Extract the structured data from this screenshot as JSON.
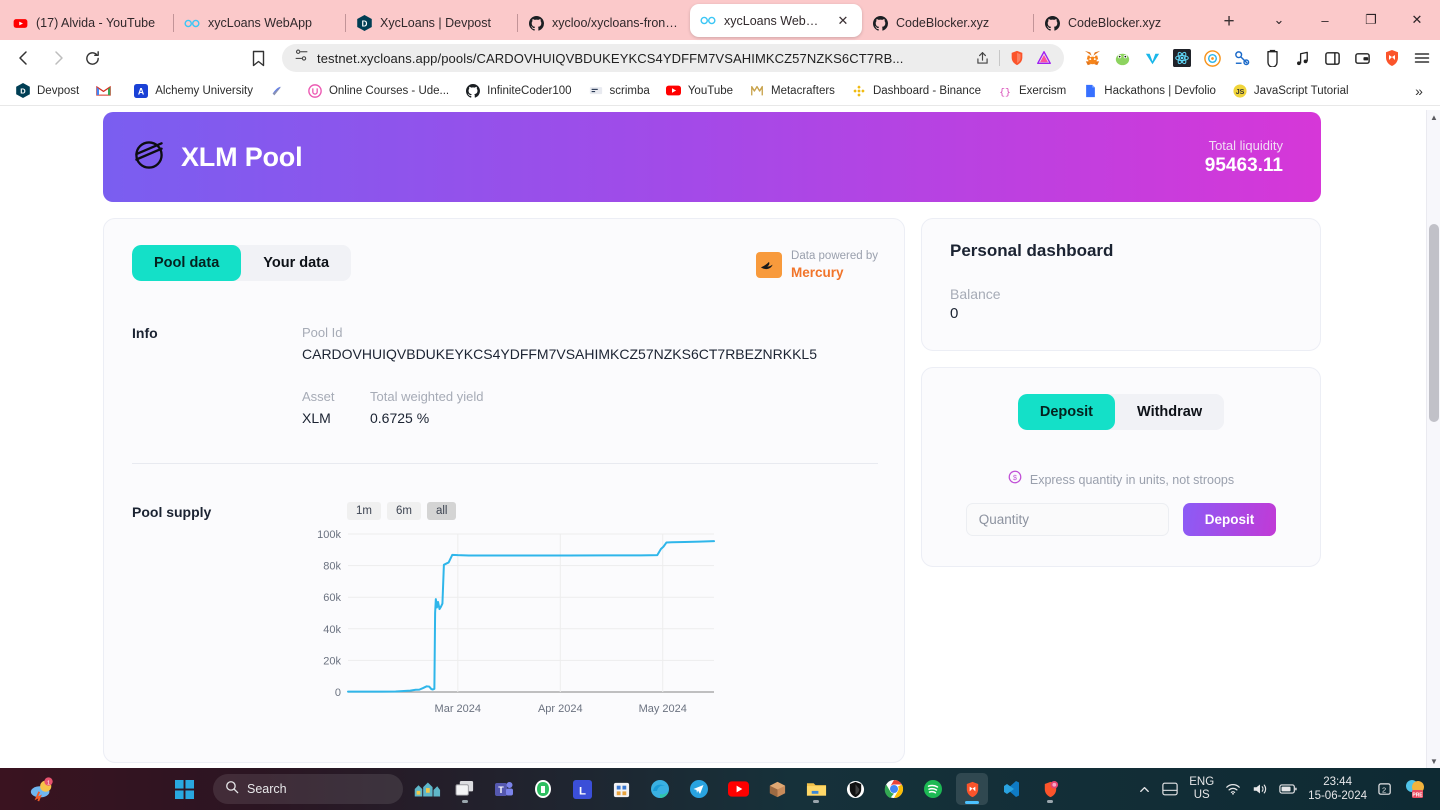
{
  "browser": {
    "tabs": [
      {
        "title": "(17) Alvida - YouTube",
        "icon": "youtube-icon",
        "active": false
      },
      {
        "title": "xycLoans WebApp",
        "icon": "infinity-icon",
        "active": false
      },
      {
        "title": "XycLoans | Devpost",
        "icon": "devpost-icon",
        "active": false
      },
      {
        "title": "xycloo/xycloans-frontend:",
        "icon": "github-icon",
        "active": false
      },
      {
        "title": "xycLoans WebApp",
        "icon": "infinity-icon",
        "active": true
      },
      {
        "title": "CodeBlocker.xyz",
        "icon": "github-icon",
        "active": false
      },
      {
        "title": "CodeBlocker.xyz",
        "icon": "github-icon",
        "active": false
      }
    ],
    "new_tab_label": "+",
    "window_controls": [
      "⌄",
      "–",
      "❐",
      "✕"
    ],
    "nav": {
      "back": "‹",
      "forward": "›",
      "reload": "⟳",
      "bookmark": "☐"
    },
    "address": {
      "host": "testnet.xycloans.app",
      "path": "/pools/CARDOVHUIQVBDUKEYKCS4YDFFM7VSAHIMKCZ57NZKS6CT7RB...",
      "full": "testnet.xycloans.app/pools/CARDOVHUIQVBDUKEYKCS4YDFFM7VSAHIMKCZ57NZKS6CT7RB..."
    },
    "bookmarks": [
      {
        "label": "Devpost",
        "icon": "devpost-icon"
      },
      {
        "label": "",
        "icon": "gmail-icon"
      },
      {
        "label": "Alchemy University",
        "icon": "alchemy-icon"
      },
      {
        "label": "",
        "icon": "ethereum-dev-icon"
      },
      {
        "label": "Online Courses - Ude...",
        "icon": "udemy-icon"
      },
      {
        "label": "InfiniteCoder100",
        "icon": "github-icon"
      },
      {
        "label": "scrimba",
        "icon": "scrimba-icon"
      },
      {
        "label": "YouTube",
        "icon": "youtube-icon"
      },
      {
        "label": "Metacrafters",
        "icon": "metacrafters-icon"
      },
      {
        "label": "Dashboard - Binance",
        "icon": "binance-icon"
      },
      {
        "label": "Exercism",
        "icon": "exercism-icon"
      },
      {
        "label": "Hackathons | Devfolio",
        "icon": "devfolio-icon"
      },
      {
        "label": "JavaScript Tutorial",
        "icon": "javascript-icon"
      }
    ],
    "bookmarks_overflow": "»"
  },
  "hero": {
    "title": "XLM Pool",
    "logo_icon": "stellar-icon",
    "liquidity_label": "Total liquidity",
    "liquidity_value": "95463.11",
    "gradient_from": "#7a5ef0",
    "gradient_to": "#d637d8"
  },
  "pool": {
    "tabs": [
      {
        "label": "Pool data",
        "active": true
      },
      {
        "label": "Your data",
        "active": false
      }
    ],
    "accent_color": "#14e0c8",
    "mercury": {
      "caption": "Data powered by",
      "name": "Mercury",
      "icon": "mercury-wing-icon",
      "brand_color": "#f1742a"
    },
    "info": {
      "section_label": "Info",
      "pool_id_label": "Pool Id",
      "pool_id_value": "CARDOVHUIQVBDUKEYKCS4YDFFM7VSAHIMKCZ57NZKS6CT7RBEZNRKKL5",
      "asset_label": "Asset",
      "asset_value": "XLM",
      "yield_label": "Total weighted yield",
      "yield_value": "0.6725 %"
    },
    "chart_label": "Pool supply",
    "ranges": [
      {
        "label": "1m",
        "active": false
      },
      {
        "label": "6m",
        "active": false
      },
      {
        "label": "all",
        "active": true
      }
    ]
  },
  "chart_data": {
    "type": "line",
    "title": "Pool supply",
    "xlabel": "",
    "ylabel": "",
    "line_color": "#2fb6ea",
    "grid": true,
    "legend": "none",
    "ylim": [
      0,
      100000
    ],
    "ytick_labels": [
      "0",
      "20k",
      "40k",
      "60k",
      "80k",
      "100k"
    ],
    "ytick_values": [
      0,
      20000,
      40000,
      60000,
      80000,
      100000
    ],
    "xtick_labels": [
      "Mar 2024",
      "Apr 2024",
      "May 2024"
    ],
    "xtick_positions": [
      0.3,
      0.58,
      0.86
    ],
    "series": [
      {
        "name": "Pool supply",
        "x": [
          0.0,
          0.07,
          0.13,
          0.17,
          0.185,
          0.195,
          0.205,
          0.215,
          0.222,
          0.228,
          0.232,
          0.236,
          0.238,
          0.24,
          0.243,
          0.246,
          0.25,
          0.254,
          0.258,
          0.262,
          0.268,
          0.275,
          0.285,
          0.3,
          0.33,
          0.4,
          0.5,
          0.6,
          0.7,
          0.8,
          0.845,
          0.855,
          0.862,
          0.87,
          0.885,
          0.92,
          0.96,
          1.0
        ],
        "y": [
          200,
          250,
          300,
          900,
          1400,
          1500,
          2500,
          3600,
          3400,
          1800,
          1600,
          2000,
          50000,
          58800,
          53500,
          57000,
          52500,
          54000,
          56000,
          80500,
          81200,
          82000,
          86800,
          86600,
          86400,
          86400,
          86400,
          86400,
          86500,
          86500,
          86600,
          90500,
          92000,
          94600,
          94800,
          94900,
          95200,
          95463
        ]
      }
    ]
  },
  "dashboard": {
    "title": "Personal dashboard",
    "balance_label": "Balance",
    "balance_value": "0"
  },
  "action_panel": {
    "tabs": [
      {
        "label": "Deposit",
        "active": true
      },
      {
        "label": "Withdraw",
        "active": false
      }
    ],
    "hint_icon": "info-coin-icon",
    "hint_text": "Express quantity in units, not stroops",
    "quantity_placeholder": "Quantity",
    "quantity_value": "",
    "submit_label": "Deposit"
  },
  "taskbar": {
    "search_placeholder": "Search",
    "search_icon": "search-icon",
    "start_icon": "windows-icon",
    "apps": [
      {
        "name": "start-icon"
      },
      {
        "name": "search-box"
      },
      {
        "name": "widgets-icon"
      },
      {
        "name": "task-view-icon"
      },
      {
        "name": "teams-icon"
      },
      {
        "name": "evernote-icon"
      },
      {
        "name": "lightshot-icon"
      },
      {
        "name": "store-icon"
      },
      {
        "name": "edge-icon"
      },
      {
        "name": "telegram-icon"
      },
      {
        "name": "youtube-icon"
      },
      {
        "name": "minecraft-icon"
      },
      {
        "name": "file-explorer-icon"
      },
      {
        "name": "brave-icon"
      },
      {
        "name": "chrome-icon"
      },
      {
        "name": "spotify-icon"
      },
      {
        "name": "brave-active-icon"
      },
      {
        "name": "vscode-icon"
      },
      {
        "name": "brave-beta-icon"
      }
    ],
    "language": {
      "line1": "ENG",
      "line2": "US"
    },
    "clock": {
      "time": "23:44",
      "date": "15-06-2024"
    },
    "tray_icons": [
      "chevron-up-icon",
      "touchpad-icon",
      "wifi-icon",
      "volume-icon",
      "battery-icon"
    ]
  }
}
